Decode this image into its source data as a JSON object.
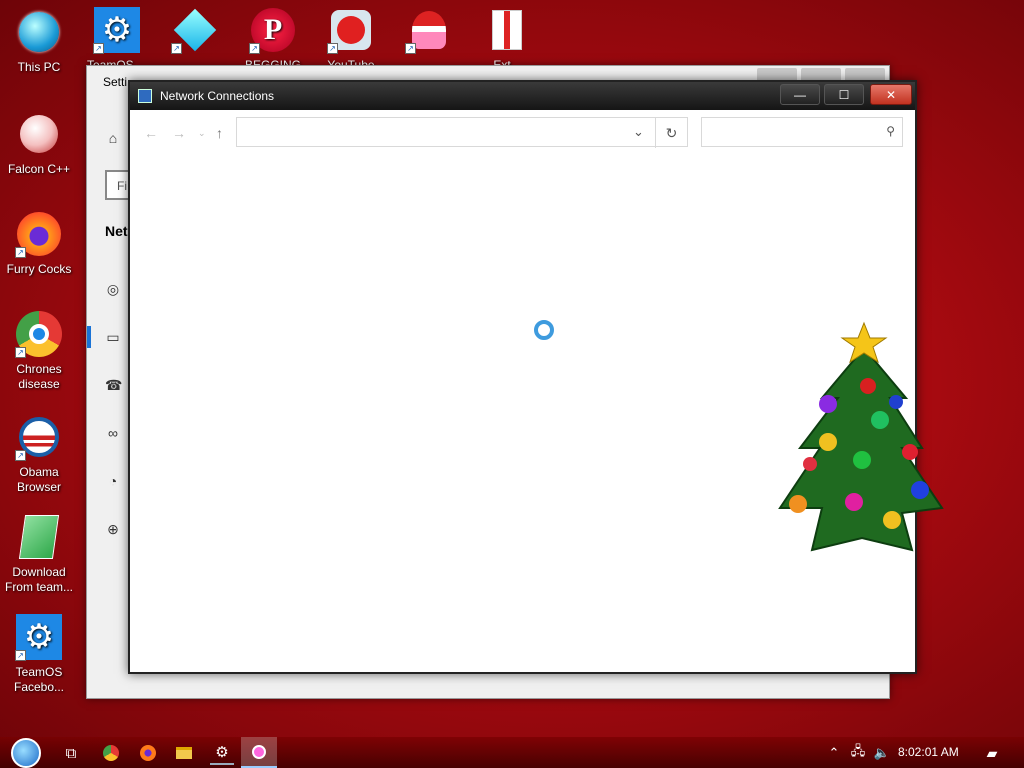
{
  "desktop": {
    "left_icons": [
      {
        "label": "This PC",
        "icon": "monitor-icon"
      },
      {
        "label": "Falcon C++",
        "icon": "recycle-bin-icon"
      },
      {
        "label": "Furry Cocks",
        "icon": "firefox-icon"
      },
      {
        "label": "Chrones disease",
        "icon": "chrome-icon"
      },
      {
        "label": "Obama Browser",
        "icon": "obama-logo-icon"
      },
      {
        "label": "Download From team...",
        "icon": "notepad-icon"
      },
      {
        "label": "TeamOS Facebo...",
        "icon": "gear-icon"
      }
    ],
    "top_icons": [
      {
        "label": "TeamOS ...",
        "icon": "gear-icon"
      },
      {
        "label": "...",
        "icon": "diamond-icon"
      },
      {
        "label": "BEGGING LOL",
        "icon": "p-logo-icon"
      },
      {
        "label": "YouTube",
        "icon": "angry-bird-icon"
      },
      {
        "label": "...",
        "icon": "santa-icon"
      },
      {
        "label": "Ext...",
        "icon": "gift-icon"
      }
    ]
  },
  "settings_window": {
    "title": "Setti",
    "search_placeholder": "Fi",
    "heading": "Net",
    "nav_icons": [
      "home-icon",
      "globe-grid-icon",
      "ethernet-icon",
      "dialup-icon",
      "vpn-icon",
      "data-usage-icon",
      "globe-icon"
    ]
  },
  "net_window": {
    "title": "Network Connections",
    "address_value": "",
    "search_placeholder": "",
    "buttons": {
      "minimize": "—",
      "maximize": "☐",
      "close": "✕"
    },
    "loading": true
  },
  "taskbar": {
    "icons": [
      "start-orb-icon",
      "task-view-icon",
      "chrome-icon",
      "firefox-icon",
      "file-explorer-icon",
      "settings-icon",
      "network-app-icon"
    ],
    "tray_icons": [
      "chevron-up-icon",
      "network-icon",
      "volume-icon"
    ],
    "clock": "8:02:01 AM",
    "notification_icon": "action-center-icon"
  },
  "colors": {
    "desktop_red": "#c0101a",
    "titlebar_dark": "#1e1e1e",
    "close_red": "#d0402c",
    "spinner_blue": "#1c8ad8"
  }
}
